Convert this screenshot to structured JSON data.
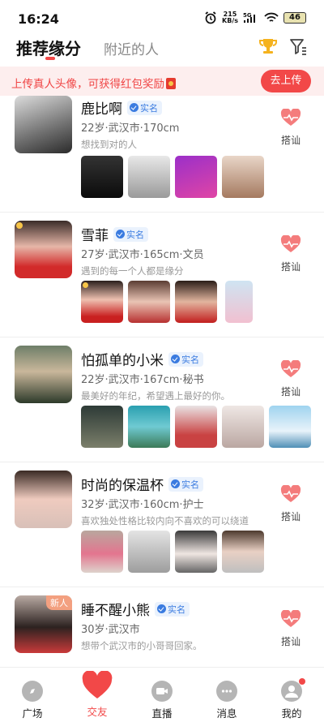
{
  "status": {
    "time": "16:24",
    "net_speed": "215",
    "net_unit": "KB/s",
    "net_type": "5G",
    "battery": "46"
  },
  "header": {
    "tab_active": "推荐缘分",
    "tab_inactive": "附近的人"
  },
  "banner": {
    "text": "上传真人头像，可获得红包奖励",
    "button": "去上传"
  },
  "verified_label": "实名",
  "chat_label": "搭讪",
  "cards": [
    {
      "name": "鹿比啊",
      "info": "22岁·武汉市·170cm",
      "bio": "想找到对的人",
      "new": ""
    },
    {
      "name": "雪菲",
      "info": "27岁·武汉市·165cm·文员",
      "bio": "遇到的每一个人都是缘分",
      "new": ""
    },
    {
      "name": "怕孤单的小米",
      "info": "22岁·武汉市·167cm·秘书",
      "bio": "最美好的年纪，希望遇上最好的你。",
      "new": ""
    },
    {
      "name": "时尚的保温杯",
      "info": "32岁·武汉市·160cm·护士",
      "bio": "喜欢独处性格比较内向不喜欢的可以绕道",
      "new": ""
    },
    {
      "name": "睡不醒小熊",
      "info": "30岁·武汉市",
      "bio": "想带个武汉市的小哥哥回家。",
      "new": "新人"
    }
  ],
  "nav": [
    {
      "label": "广场"
    },
    {
      "label": "交友"
    },
    {
      "label": "直播"
    },
    {
      "label": "消息"
    },
    {
      "label": "我的"
    }
  ]
}
